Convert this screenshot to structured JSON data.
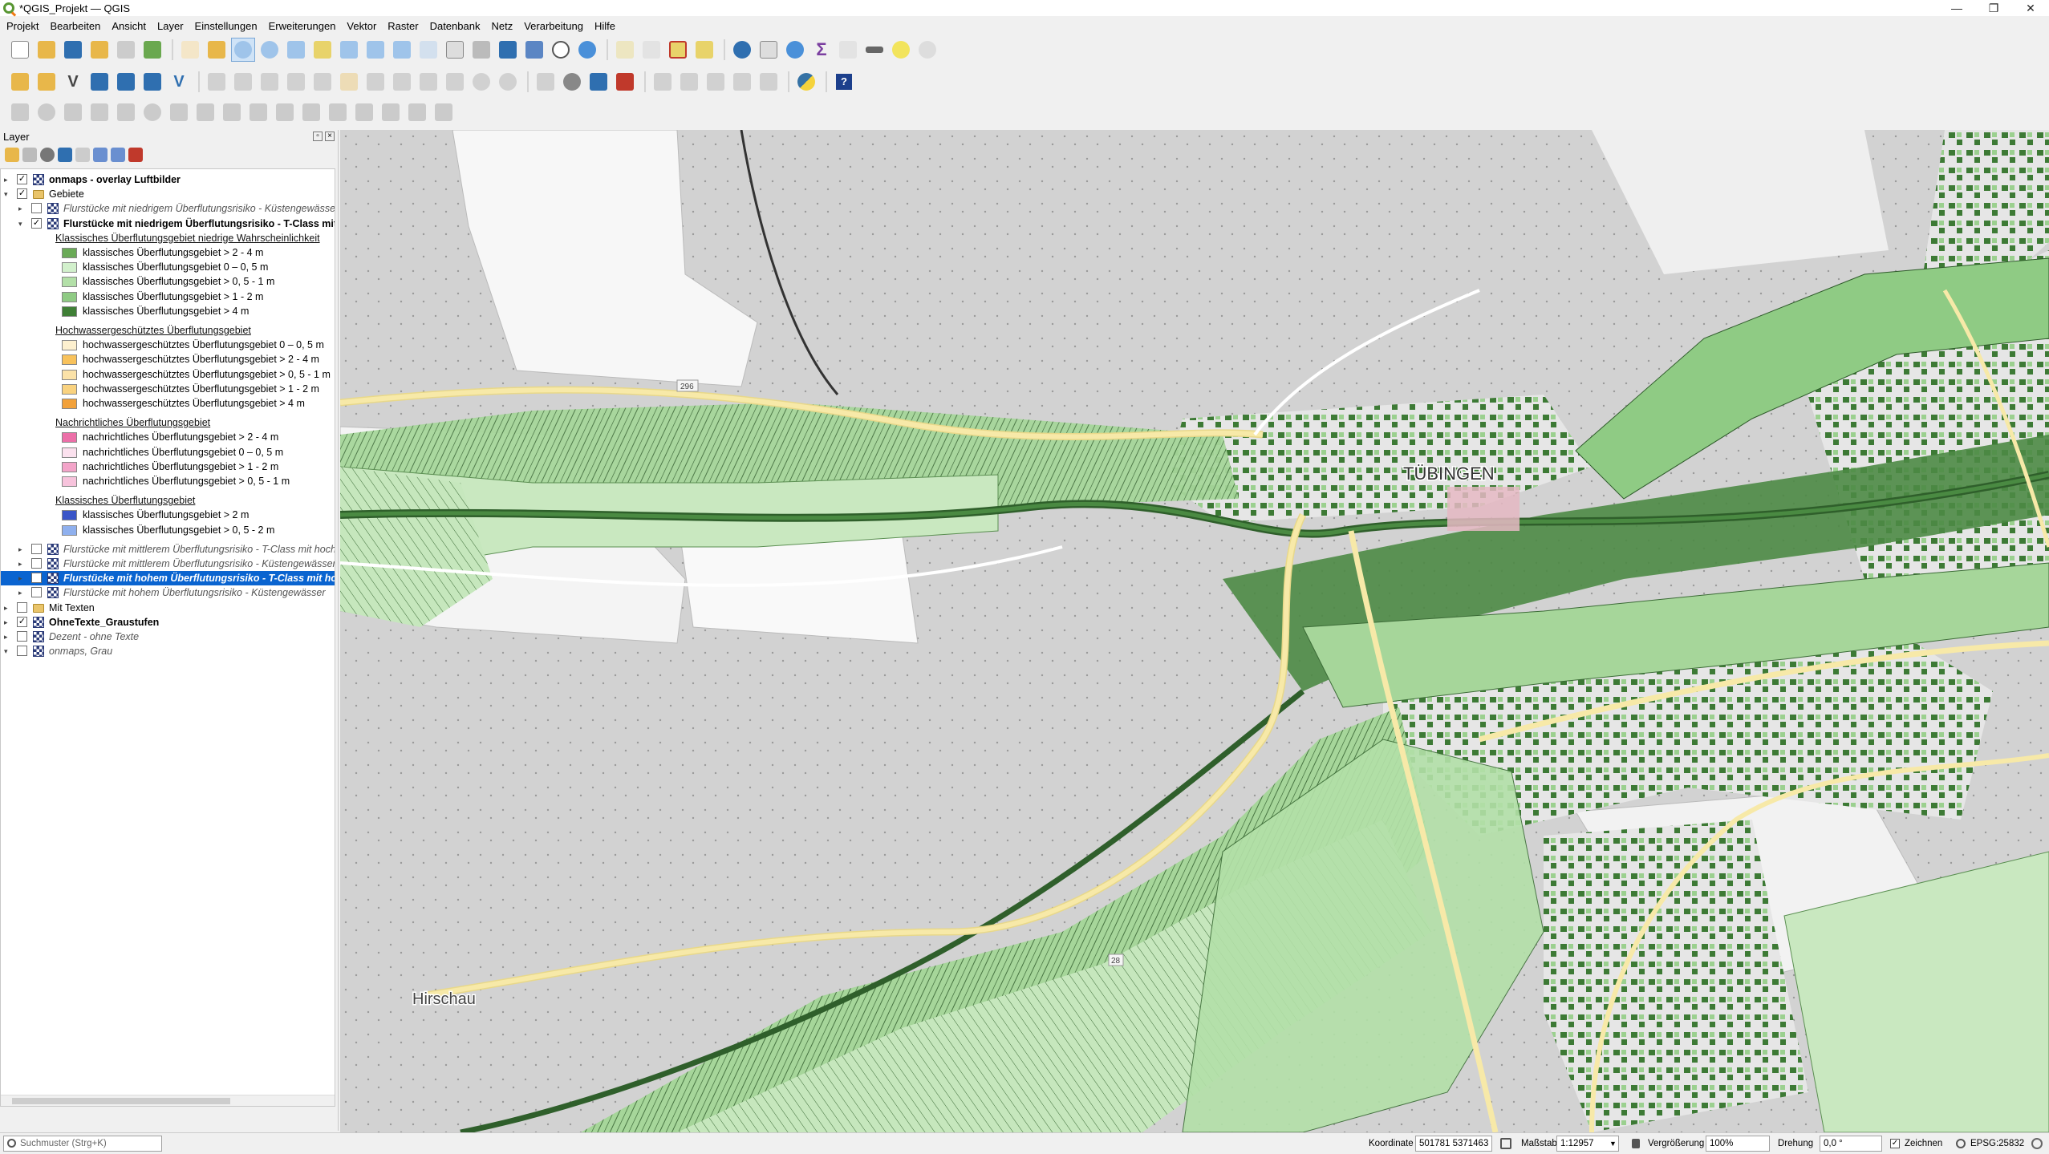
{
  "window": {
    "title": "*QGIS_Projekt — QGIS"
  },
  "window_controls": [
    "—",
    "❐",
    "✕"
  ],
  "menubar": [
    "Projekt",
    "Bearbeiten",
    "Ansicht",
    "Layer",
    "Einstellungen",
    "Erweiterungen",
    "Vektor",
    "Raster",
    "Datenbank",
    "Netz",
    "Verarbeitung",
    "Hilfe"
  ],
  "layers_panel": {
    "title": "Layer",
    "rows": [
      {
        "text": "onmaps - overlay Luftbilder",
        "style": "bold",
        "checked": true,
        "expanded": false,
        "icon": "raster-grid-icon",
        "level": 0
      },
      {
        "text": "Gebiete",
        "style": "normal",
        "checked": true,
        "expanded": true,
        "icon": "group-folder-icon",
        "level": 0
      },
      {
        "text": "Flurstücke mit niedrigem Überflutungsrisiko - Küstengewässer",
        "style": "italic",
        "checked": false,
        "expanded": false,
        "icon": "raster-grid-icon",
        "level": 1
      },
      {
        "text": "Flurstücke mit niedrigem Überflutungsrisiko - T-Class mit hochwassergeschützt",
        "style": "bold",
        "checked": true,
        "expanded": true,
        "icon": "raster-grid-icon",
        "level": 1
      },
      {
        "text": "Klassisches Überflutungsgebiet niedrige Wahrscheinlichkeit",
        "style": "grouphead",
        "level": 2
      },
      {
        "text": "klassisches Überflutungsgebiet > 2 - 4 m",
        "swatch": "#6aaa57",
        "level": 3
      },
      {
        "text": "klassisches Überflutungsgebiet 0 – 0, 5 m",
        "swatch": "#d2f0cc",
        "level": 3
      },
      {
        "text": "klassisches Überflutungsgebiet > 0, 5 - 1 m",
        "swatch": "#b3e0a8",
        "level": 3
      },
      {
        "text": "klassisches Überflutungsgebiet > 1 - 2 m",
        "swatch": "#8fcb84",
        "level": 3
      },
      {
        "text": "klassisches Überflutungsgebiet > 4 m",
        "swatch": "#3f7f36",
        "level": 3
      },
      {
        "text": "Hochwassergeschütztes Überflutungsgebiet",
        "style": "grouphead",
        "level": 2,
        "gap": true
      },
      {
        "text": "hochwassergeschütztes Überflutungsgebiet 0 – 0, 5 m",
        "swatch": "#fdf0cf",
        "level": 3
      },
      {
        "text": "hochwassergeschütztes Überflutungsgebiet > 2 - 4 m",
        "swatch": "#f8c25c",
        "level": 3
      },
      {
        "text": "hochwassergeschütztes Überflutungsgebiet > 0, 5 - 1 m",
        "swatch": "#fbe2a8",
        "level": 3
      },
      {
        "text": "hochwassergeschütztes Überflutungsgebiet > 1 - 2 m",
        "swatch": "#f9d27f",
        "level": 3
      },
      {
        "text": "hochwassergeschütztes Überflutungsgebiet > 4 m",
        "swatch": "#f2a13a",
        "level": 3
      },
      {
        "text": "Nachrichtliches Überflutungsgebiet",
        "style": "grouphead",
        "level": 2,
        "gap": true
      },
      {
        "text": "nachrichtliches Überflutungsgebiet > 2 - 4 m",
        "swatch": "#ec6fa8",
        "level": 3
      },
      {
        "text": "nachrichtliches Überflutungsgebiet 0 – 0, 5 m",
        "swatch": "#fbe1ee",
        "level": 3
      },
      {
        "text": "nachrichtliches Überflutungsgebiet > 1 - 2 m",
        "swatch": "#f3a4c9",
        "level": 3
      },
      {
        "text": "nachrichtliches Überflutungsgebiet > 0, 5 - 1 m",
        "swatch": "#f7c3dc",
        "level": 3
      },
      {
        "text": "Klassisches Überflutungsgebiet",
        "style": "grouphead",
        "level": 2,
        "gap": true
      },
      {
        "text": "klassisches Überflutungsgebiet > 2 m",
        "swatch": "#3a55c8",
        "level": 3
      },
      {
        "text": "klassisches Überflutungsgebiet > 0, 5 - 2 m",
        "swatch": "#8fb0ee",
        "level": 3
      },
      {
        "text": "Flurstücke mit mittlerem Überflutungsrisiko - T-Class mit hochwassergeschützt",
        "style": "italic",
        "checked": false,
        "expanded": false,
        "icon": "raster-grid-icon",
        "level": 1,
        "gap": true
      },
      {
        "text": "Flurstücke mit mittlerem Überflutungsrisiko - Küstengewässer",
        "style": "italic",
        "checked": false,
        "expanded": false,
        "icon": "raster-grid-icon",
        "level": 1
      },
      {
        "text": "Flurstücke mit hohem Überflutungsrisiko - T-Class mit hochwassergeschützt",
        "style": "bolditalic",
        "checked": false,
        "expanded": false,
        "icon": "raster-grid-icon",
        "level": 1,
        "selected": true
      },
      {
        "text": "Flurstücke mit hohem Überflutungsrisiko - Küstengewässer",
        "style": "italic",
        "checked": false,
        "expanded": false,
        "icon": "raster-grid-icon",
        "level": 1
      },
      {
        "text": "Mit Texten",
        "style": "normal",
        "checked": false,
        "expanded": false,
        "icon": "group-folder-icon",
        "level": 0
      },
      {
        "text": "OhneTexte_Graustufen",
        "style": "bold",
        "checked": true,
        "expanded": false,
        "icon": "raster-grid-icon",
        "level": 0
      },
      {
        "text": "Dezent - ohne Texte",
        "style": "italic",
        "checked": false,
        "expanded": false,
        "icon": "raster-grid-icon",
        "level": 0
      },
      {
        "text": "onmaps, Grau",
        "style": "italic",
        "checked": false,
        "expanded": true,
        "icon": "raster-grid-icon",
        "level": 0
      }
    ]
  },
  "map": {
    "labels": {
      "city": "TÜBINGEN",
      "town": "Hirschau",
      "road_296": "296",
      "road_28": "28"
    },
    "colors": {
      "background": "#d9d9d9",
      "road": "#f7e9a8",
      "flood_light": "#c9e8c0",
      "flood_mid": "#8fcb84",
      "flood_dark": "#3f7f36"
    }
  },
  "statusbar": {
    "search_placeholder": "Suchmuster (Strg+K)",
    "coordinate_label": "Koordinate",
    "coordinate_value": "501781  5371463",
    "scale_label": "Maßstab",
    "scale_value": "1:12957",
    "magnifier_label": "Vergrößerung",
    "magnifier_value": "100%",
    "rotation_label": "Drehung",
    "rotation_value": "0,0 °",
    "render_label": "Zeichnen",
    "crs": "EPSG:25832"
  },
  "toolbar_colors": [
    "#f4f4f4",
    "#e8b74a",
    "#2f6fb0",
    "#c0392b",
    "#6aa84f",
    "#7a7a7a"
  ]
}
